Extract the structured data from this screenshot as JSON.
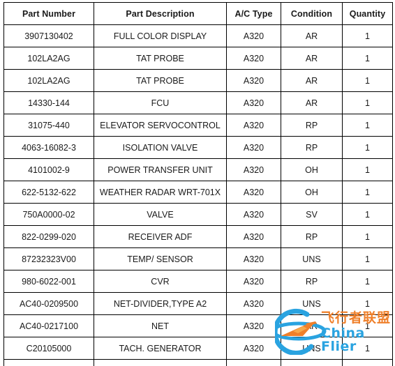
{
  "document": {
    "type": "parts-inventory-table"
  },
  "table": {
    "columns": [
      {
        "key": "part_number",
        "label": "Part Number"
      },
      {
        "key": "part_description",
        "label": "Part Description"
      },
      {
        "key": "ac_type",
        "label": "A/C Type"
      },
      {
        "key": "condition",
        "label": "Condition"
      },
      {
        "key": "quantity",
        "label": "Quantity"
      }
    ],
    "rows": [
      {
        "part_number": "3907130402",
        "part_description": "FULL COLOR DISPLAY",
        "ac_type": "A320",
        "condition": "AR",
        "quantity": "1"
      },
      {
        "part_number": "102LA2AG",
        "part_description": "TAT PROBE",
        "ac_type": "A320",
        "condition": "AR",
        "quantity": "1"
      },
      {
        "part_number": "102LA2AG",
        "part_description": "TAT PROBE",
        "ac_type": "A320",
        "condition": "AR",
        "quantity": "1"
      },
      {
        "part_number": "14330-144",
        "part_description": "FCU",
        "ac_type": "A320",
        "condition": "AR",
        "quantity": "1"
      },
      {
        "part_number": "31075-440",
        "part_description": "ELEVATOR SERVOCONTROL",
        "ac_type": "A320",
        "condition": "RP",
        "quantity": "1"
      },
      {
        "part_number": "4063-16082-3",
        "part_description": "ISOLATION VALVE",
        "ac_type": "A320",
        "condition": "RP",
        "quantity": "1"
      },
      {
        "part_number": "4101002-9",
        "part_description": "POWER TRANSFER UNIT",
        "ac_type": "A320",
        "condition": "OH",
        "quantity": "1"
      },
      {
        "part_number": "622-5132-622",
        "part_description": "WEATHER RADAR WRT-701X",
        "ac_type": "A320",
        "condition": "OH",
        "quantity": "1"
      },
      {
        "part_number": "750A0000-02",
        "part_description": "VALVE",
        "ac_type": "A320",
        "condition": "SV",
        "quantity": "1"
      },
      {
        "part_number": "822-0299-020",
        "part_description": "RECEIVER ADF",
        "ac_type": "A320",
        "condition": "RP",
        "quantity": "1"
      },
      {
        "part_number": "87232323V00",
        "part_description": "TEMP/ SENSOR",
        "ac_type": "A320",
        "condition": "UNS",
        "quantity": "1"
      },
      {
        "part_number": "980-6022-001",
        "part_description": "CVR",
        "ac_type": "A320",
        "condition": "RP",
        "quantity": "1"
      },
      {
        "part_number": "AC40-0209500",
        "part_description": "NET-DIVIDER,TYPE A2",
        "ac_type": "A320",
        "condition": "UNS",
        "quantity": "1"
      },
      {
        "part_number": "AC40-0217100",
        "part_description": "NET",
        "ac_type": "A320",
        "condition": "AR",
        "quantity": "1"
      },
      {
        "part_number": "C20105000",
        "part_description": "TACH. GENERATOR",
        "ac_type": "A320",
        "condition": "UNS",
        "quantity": "1"
      }
    ]
  },
  "watermark": {
    "chinese_text": "飞行者联盟",
    "english_text": "China Flier",
    "logo_icon": "airplane-globe-icon",
    "colors": {
      "chinese": "#ef7f2a",
      "english": "#2aa3e0",
      "ring": "#2aa3e0",
      "plane": "#ef7f2a"
    }
  }
}
